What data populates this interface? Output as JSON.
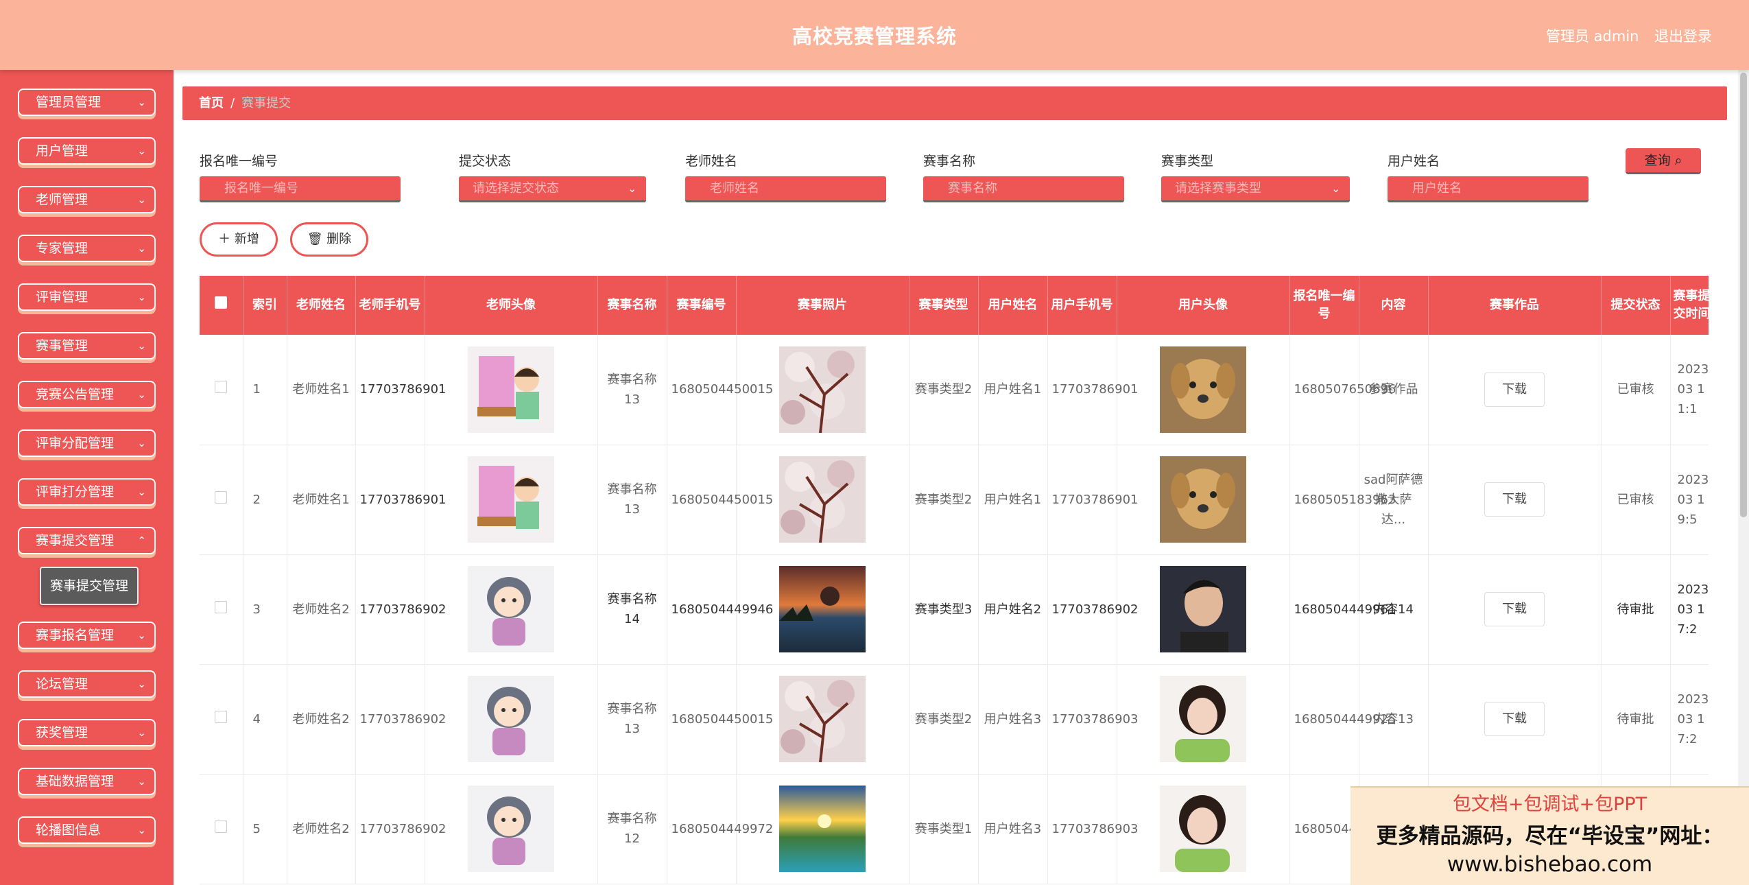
{
  "header": {
    "title": "高校竞赛管理系统",
    "user": "管理员 admin",
    "logout": "退出登录"
  },
  "sidebar": {
    "items": [
      {
        "label": "管理员管理"
      },
      {
        "label": "用户管理"
      },
      {
        "label": "老师管理"
      },
      {
        "label": "专家管理"
      },
      {
        "label": "评审管理"
      },
      {
        "label": "赛事管理"
      },
      {
        "label": "竞赛公告管理"
      },
      {
        "label": "评审分配管理"
      },
      {
        "label": "评审打分管理"
      },
      {
        "label": "赛事提交管理"
      },
      {
        "label": "赛事报名管理"
      },
      {
        "label": "论坛管理"
      },
      {
        "label": "获奖管理"
      },
      {
        "label": "基础数据管理"
      },
      {
        "label": "轮播图信息"
      }
    ],
    "active_sub": "赛事提交管理"
  },
  "breadcrumb": {
    "home": "首页",
    "sep": "/",
    "current": "赛事提交"
  },
  "filters": [
    {
      "label": "报名唯一编号",
      "placeholder": "报名唯一编号"
    },
    {
      "label": "提交状态",
      "placeholder": "请选择提交状态"
    },
    {
      "label": "老师姓名",
      "placeholder": "老师姓名"
    },
    {
      "label": "赛事名称",
      "placeholder": "赛事名称"
    },
    {
      "label": "赛事类型",
      "placeholder": "请选择赛事类型"
    },
    {
      "label": "用户姓名",
      "placeholder": "用户姓名"
    }
  ],
  "actions": {
    "query": "查询",
    "add": "新增",
    "delete": "删除"
  },
  "table": {
    "headers": [
      "索引",
      "老师姓名",
      "老师手机号",
      "老师头像",
      "赛事名称",
      "赛事编号",
      "赛事照片",
      "赛事类型",
      "用户姓名",
      "用户手机号",
      "用户头像",
      "报名唯一编号",
      "内容",
      "赛事作品",
      "提交状态",
      "赛事提交时间"
    ],
    "rows": [
      {
        "index": "1",
        "teacher": "老师姓名1",
        "tphone": "17703786901",
        "event": "赛事名称13",
        "code": "1680504450015",
        "type": "赛事类型2",
        "user": "用户姓名1",
        "uphone": "17703786901",
        "reg": "1680507650696",
        "content": "参赛作品",
        "download": "下载",
        "status": "已审核",
        "time": "2023-03 1 1:1"
      },
      {
        "index": "2",
        "teacher": "老师姓名1",
        "tphone": "17703786901",
        "event": "赛事名称13",
        "code": "1680504450015",
        "type": "赛事类型2",
        "user": "用户姓名1",
        "uphone": "17703786901",
        "reg": "1680505183963",
        "content": "sad阿萨德撒大萨达...",
        "download": "下载",
        "status": "已审核",
        "time": "2023-03 1 9:5"
      },
      {
        "index": "3",
        "teacher": "老师姓名2",
        "tphone": "17703786902",
        "event": "赛事名称14",
        "code": "1680504449946",
        "type": "赛事类型3",
        "user": "用户姓名2",
        "uphone": "17703786902",
        "reg": "1680504449961",
        "content": "内容14",
        "download": "下载",
        "status": "待审批",
        "time": "2023-03 1 7:2"
      },
      {
        "index": "4",
        "teacher": "老师姓名2",
        "tphone": "17703786902",
        "event": "赛事名称13",
        "code": "1680504450015",
        "type": "赛事类型2",
        "user": "用户姓名3",
        "uphone": "17703786903",
        "reg": "1680504449925",
        "content": "内容13",
        "download": "下载",
        "status": "待审批",
        "time": "2023-03 1 7:2"
      },
      {
        "index": "5",
        "teacher": "老师姓名2",
        "tphone": "17703786902",
        "event": "赛事名称12",
        "code": "1680504449972",
        "type": "赛事类型1",
        "user": "用户姓名3",
        "uphone": "17703786903",
        "reg": "1680504449964",
        "content": "",
        "download": "",
        "status": "",
        "time": ""
      }
    ]
  },
  "ad": {
    "line1": "包文档+包调试+包PPT",
    "line2": "更多精品源码，尽在“毕设宝”网址：",
    "line3": "www.bishebao.com"
  }
}
